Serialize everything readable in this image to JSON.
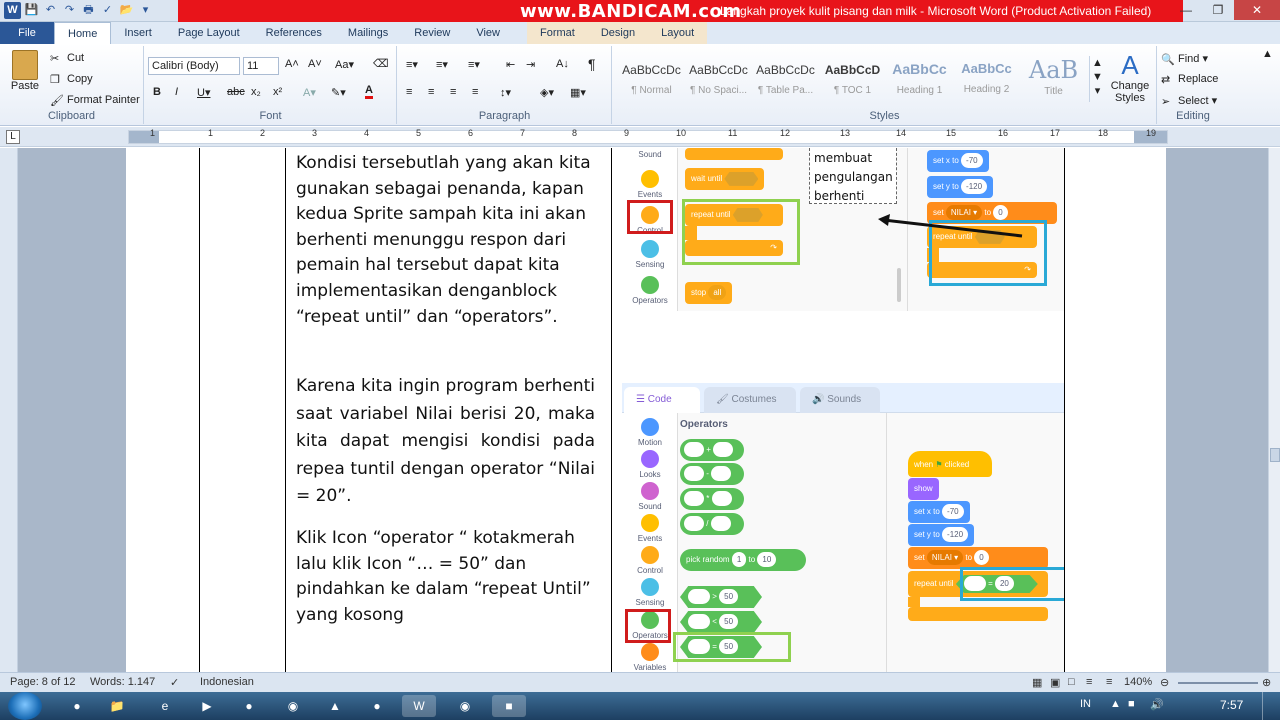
{
  "window": {
    "title": "Langkah proyek kulit pisang dan milk  -  Microsoft Word (Product Activation Failed)",
    "recorder_watermark": "www.BANDICAM.com",
    "title_prefix": "D"
  },
  "tabs": [
    "File",
    "Home",
    "Insert",
    "Page Layout",
    "References",
    "Mailings",
    "Review",
    "View",
    "Format",
    "Design",
    "Layout"
  ],
  "ribbon": {
    "clipboard": {
      "paste": "Paste",
      "cut": "Cut",
      "copy": "Copy",
      "format_painter": "Format Painter",
      "label": "Clipboard"
    },
    "font": {
      "name": "Calibri (Body)",
      "size": "11",
      "label": "Font"
    },
    "paragraph": {
      "label": "Paragraph"
    },
    "styles": {
      "label": "Styles",
      "items": [
        {
          "sample": "AaBbCcDc",
          "name": "¶ Normal"
        },
        {
          "sample": "AaBbCcDc",
          "name": "¶ No Spaci..."
        },
        {
          "sample": "AaBbCcDc",
          "name": "¶ Table Pa..."
        },
        {
          "sample": "AaBbCcD",
          "name": "¶ TOC 1"
        },
        {
          "sample": "AaBbCc",
          "name": "Heading 1"
        },
        {
          "sample": "AaBbCc",
          "name": "Heading 2"
        },
        {
          "sample": "AaB",
          "name": "Title"
        }
      ],
      "change_styles": "Change Styles"
    },
    "editing": {
      "find": "Find",
      "replace": "Replace",
      "select": "Select",
      "label": "Editing"
    }
  },
  "ruler": [
    "1",
    "1",
    "2",
    "3",
    "4",
    "5",
    "6",
    "7",
    "8",
    "9",
    "10",
    "11",
    "12",
    "13",
    "14",
    "15",
    "16",
    "17",
    "18",
    "19"
  ],
  "document": {
    "para1": "Kondisi tersebutlah yang akan kita gunakan sebagai penanda, kapan kedua Sprite sampah kita ini akan berhenti menunggu respon dari pemain  hal tersebut dapat kita implementasikan denganblock “repeat until” dan “operators”.",
    "para2": "Karena kita ingin program berhenti saat variabel Nilai berisi 20, maka kita dapat mengisi kondisi pada repea tuntil dengan operator “Nilai = 20”.",
    "para3": "Klik Icon “operator “ kotakmerah lalu klik Icon “… = 50” dan pindahkan ke dalam “repeat Until” yang kosong",
    "note_box": "membuat pengulangan berhenti"
  },
  "scratch_top": {
    "categories": [
      "Sound",
      "Events",
      "Control",
      "Sensing",
      "Operators"
    ],
    "blocks": {
      "wait_until": "wait until",
      "repeat_until": "repeat until",
      "stop": "stop",
      "stop_value": "all"
    },
    "script": {
      "set_x": "set x to",
      "x_val": "-70",
      "set_y": "set y to",
      "y_val": "-120",
      "set": "set",
      "var": "NILAI ▾",
      "to": "to",
      "var_val": "0",
      "repeat_until": "repeat until"
    }
  },
  "scratch_bottom": {
    "tabs": [
      "Code",
      "Costumes",
      "Sounds"
    ],
    "categories": [
      "Motion",
      "Looks",
      "Sound",
      "Events",
      "Control",
      "Sensing",
      "Operators",
      "Variables"
    ],
    "palette_title": "Operators",
    "ops": [
      "+",
      "-",
      "*",
      "/"
    ],
    "pick_random": {
      "label": "pick random",
      "a": "1",
      "to": "to",
      "b": "10"
    },
    "compare": [
      {
        "op": ">",
        "val": "50"
      },
      {
        "op": "<",
        "val": "50"
      },
      {
        "op": "=",
        "val": "50"
      }
    ],
    "script": {
      "when": "when",
      "clicked": "clicked",
      "show": "show",
      "set_x": "set x to",
      "x_val": "-70",
      "set_y": "set y to",
      "y_val": "-120",
      "set": "set",
      "var": "NILAI ▾",
      "to": "to",
      "var_val": "0",
      "repeat_until": "repeat until",
      "eq": "=",
      "eq_val": "20"
    }
  },
  "status": {
    "page": "Page: 8 of 12",
    "words": "Words: 1.147",
    "language": "Indonesian",
    "zoom": "140%"
  },
  "taskbar": {
    "lang": "IN",
    "time": "7:57"
  }
}
